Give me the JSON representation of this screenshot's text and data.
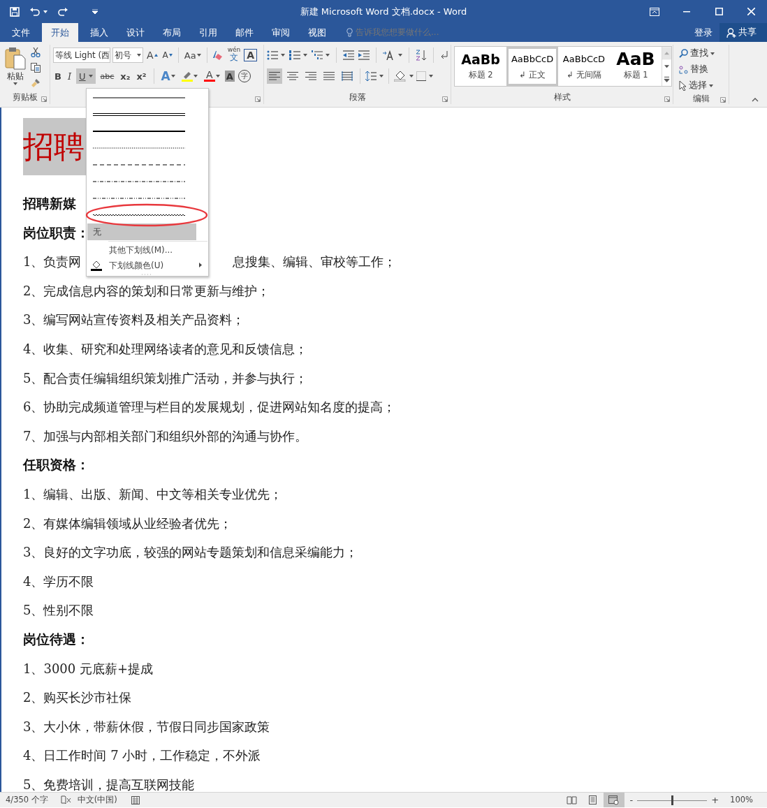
{
  "window": {
    "title": "新建 Microsoft Word 文档.docx - Word"
  },
  "tabs": [
    {
      "label": "文件",
      "selected": false
    },
    {
      "label": "开始",
      "selected": true
    },
    {
      "label": "插入",
      "selected": false
    },
    {
      "label": "设计",
      "selected": false
    },
    {
      "label": "布局",
      "selected": false
    },
    {
      "label": "引用",
      "selected": false
    },
    {
      "label": "邮件",
      "selected": false
    },
    {
      "label": "审阅",
      "selected": false
    },
    {
      "label": "视图",
      "selected": false
    }
  ],
  "tell_me": {
    "placeholder": "告诉我您想要做什么..."
  },
  "account": {
    "sign_in": "登录",
    "share": "共享"
  },
  "ribbon": {
    "clipboard": {
      "paste": "粘贴",
      "label": "剪贴板"
    },
    "font": {
      "font_name": "等线 Light (西",
      "font_size": "初号",
      "tools": [
        {
          "kind": "grow",
          "text": "A"
        },
        {
          "kind": "shrink",
          "text": "A"
        },
        {
          "kind": "case",
          "text": "Aa"
        },
        {
          "kind": "clear"
        },
        {
          "kind": "phonetic",
          "top": "wén",
          "bottom": "文"
        },
        {
          "kind": "border",
          "text": "A"
        }
      ],
      "format": [
        {
          "kind": "bold",
          "text": "B",
          "selected": false
        },
        {
          "kind": "italic",
          "text": "I",
          "selected": false
        },
        {
          "kind": "underline",
          "text": "U",
          "selected": true
        },
        {
          "kind": "strike",
          "text": "abc",
          "selected": false
        },
        {
          "kind": "sub",
          "text": "x₂",
          "selected": false
        },
        {
          "kind": "sup",
          "text": "x²",
          "selected": false
        }
      ],
      "effects": [
        {
          "kind": "effects",
          "text": "A"
        },
        {
          "kind": "highlight",
          "color": "#ffff00"
        },
        {
          "kind": "color",
          "text": "A",
          "color": "#ff0000"
        },
        {
          "kind": "shading",
          "text": "A"
        },
        {
          "kind": "enclose",
          "text": "字"
        }
      ]
    },
    "paragraph": {
      "label": "段落",
      "alignments": [
        {
          "selected": true
        },
        {
          "selected": false
        },
        {
          "selected": false
        },
        {
          "selected": false
        },
        {
          "selected": false
        }
      ]
    },
    "styles": {
      "label": "样式",
      "items": [
        {
          "preview": "AaBb",
          "label": "标题 2",
          "kind": "heading",
          "selected": false
        },
        {
          "preview": "AaBbCcD",
          "label": "↲ 正文",
          "kind": "normal",
          "selected": true
        },
        {
          "preview": "AaBbCcD",
          "label": "↲ 无间隔",
          "kind": "normal",
          "selected": false
        },
        {
          "preview": "AaB",
          "label": "标题 1",
          "kind": "title",
          "selected": false
        }
      ]
    },
    "editing": {
      "label": "编辑",
      "find": "查找",
      "replace": "替换",
      "select": "选择"
    }
  },
  "underline_menu": {
    "styles": [
      {
        "kind": "single",
        "selected": false,
        "circled": false
      },
      {
        "kind": "double",
        "selected": false,
        "circled": false
      },
      {
        "kind": "thick",
        "selected": false,
        "circled": false
      },
      {
        "kind": "dotted",
        "selected": false,
        "circled": false
      },
      {
        "kind": "dashed",
        "selected": false,
        "circled": false
      },
      {
        "kind": "dash-dot",
        "selected": false,
        "circled": false
      },
      {
        "kind": "dash-dot-dot",
        "selected": false,
        "circled": false
      },
      {
        "kind": "wave",
        "selected": false,
        "circled": true
      }
    ],
    "none": {
      "label": "无",
      "selected": true
    },
    "more_label": "其他下划线(M)...",
    "color_label": "下划线颜色(U)"
  },
  "document": [
    {
      "kind": "title",
      "text": "招聘"
    },
    {
      "kind": "heading",
      "text": "招聘新媒"
    },
    {
      "kind": "heading",
      "text": "岗位职责："
    },
    {
      "kind": "split",
      "left": "1、负责网",
      "right": "息搜集、编辑、审校等工作；"
    },
    {
      "kind": "body",
      "text": "2、完成信息内容的策划和日常更新与维护；"
    },
    {
      "kind": "body",
      "text": "3、编写网站宣传资料及相关产品资料；"
    },
    {
      "kind": "body",
      "text": "4、收集、研究和处理网络读者的意见和反馈信息；"
    },
    {
      "kind": "body",
      "text": "5、配合责任编辑组织策划推广活动，并参与执行；"
    },
    {
      "kind": "body",
      "text": "6、协助完成频道管理与栏目的发展规划，促进网站知名度的提高；"
    },
    {
      "kind": "body",
      "text": "7、加强与内部相关部门和组织外部的沟通与协作。"
    },
    {
      "kind": "heading",
      "text": "任职资格："
    },
    {
      "kind": "body",
      "text": "1、编辑、出版、新闻、中文等相关专业优先；"
    },
    {
      "kind": "body",
      "text": "2、有媒体编辑领域从业经验者优先；"
    },
    {
      "kind": "body",
      "text": "3、良好的文字功底，较强的网站专题策划和信息采编能力；"
    },
    {
      "kind": "body",
      "text": "4、学历不限"
    },
    {
      "kind": "body",
      "text": "5、性别不限"
    },
    {
      "kind": "heading",
      "text": "岗位待遇："
    },
    {
      "kind": "body",
      "text": "1、3000 元底薪+提成"
    },
    {
      "kind": "body",
      "text": "2、购买长沙市社保"
    },
    {
      "kind": "body",
      "text": "3、大小休，带薪休假，节假日同步国家政策"
    },
    {
      "kind": "body",
      "text": "4、日工作时间 7 小时，工作稳定，不外派"
    },
    {
      "kind": "body",
      "text": "5、免费培训，提高互联网技能"
    }
  ],
  "status_bar": {
    "word_count": "4/350 个字",
    "language": "中文(中国)",
    "views": [
      {
        "selected": false
      },
      {
        "selected": false
      },
      {
        "selected": true
      }
    ],
    "zoom_out": "-",
    "zoom_in": "+",
    "zoom": {
      "level": 0.5,
      "reading": "100%"
    }
  }
}
